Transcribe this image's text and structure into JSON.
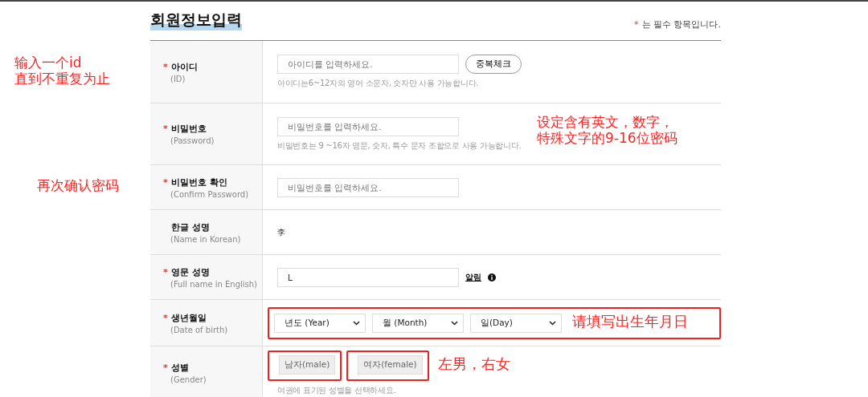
{
  "title": "회원정보입력",
  "required_note": {
    "mark": "*",
    "text": "는 필수 항목입니다."
  },
  "rows": [
    {
      "kind": "input",
      "required": true,
      "label": "아이디",
      "sublabel": "(ID)",
      "placeholder": "아이디를 입력하세요.",
      "button": "중복체크",
      "hint": "아이디는6~12자의 영어 소문자, 숫자만 사용 가능합니다."
    },
    {
      "kind": "input",
      "required": true,
      "label": "비밀번호",
      "sublabel": "(Password)",
      "placeholder": "비밀번호를 입력하세요.",
      "hint": "비밀번호는 9 ~16자 영문, 숫자, 특수 문자 조합으로 사용 가능합니다."
    },
    {
      "kind": "input",
      "required": true,
      "label": "비밀번호 확인",
      "sublabel": "(Confirm Password)",
      "placeholder": "비밀번호를 입력하세요."
    },
    {
      "kind": "text",
      "required": false,
      "label": "한글 성명",
      "sublabel": "(Name in Korean)",
      "value": "李"
    },
    {
      "kind": "input",
      "required": true,
      "label": "영문 성명",
      "sublabel": "(Full name in English)",
      "value": "L",
      "link": "알림"
    },
    {
      "kind": "selects",
      "required": true,
      "label": "생년월일",
      "sublabel": "(Date of birth)",
      "selects": [
        "년도 (Year)",
        "월 (Month)",
        "일(Day)"
      ]
    },
    {
      "kind": "gender",
      "required": true,
      "label": "성별",
      "sublabel": "(Gender)",
      "options": [
        {
          "label": "남자(male)",
          "selected": false
        },
        {
          "label": "여자(female)",
          "selected": false
        }
      ],
      "hint": "여권에 표기된 성별을 선택하세요."
    }
  ],
  "annotations": [
    {
      "lines": [
        "输入一个id",
        "直到不重复为止"
      ]
    },
    {
      "lines": [
        "设定含有英文，数字，",
        "特殊文字的9-16位密码"
      ]
    },
    {
      "lines": [
        "再次确认密码"
      ]
    },
    {
      "lines": [
        "请填写出生年月日"
      ]
    },
    {
      "lines": [
        "左男，右女"
      ]
    }
  ]
}
